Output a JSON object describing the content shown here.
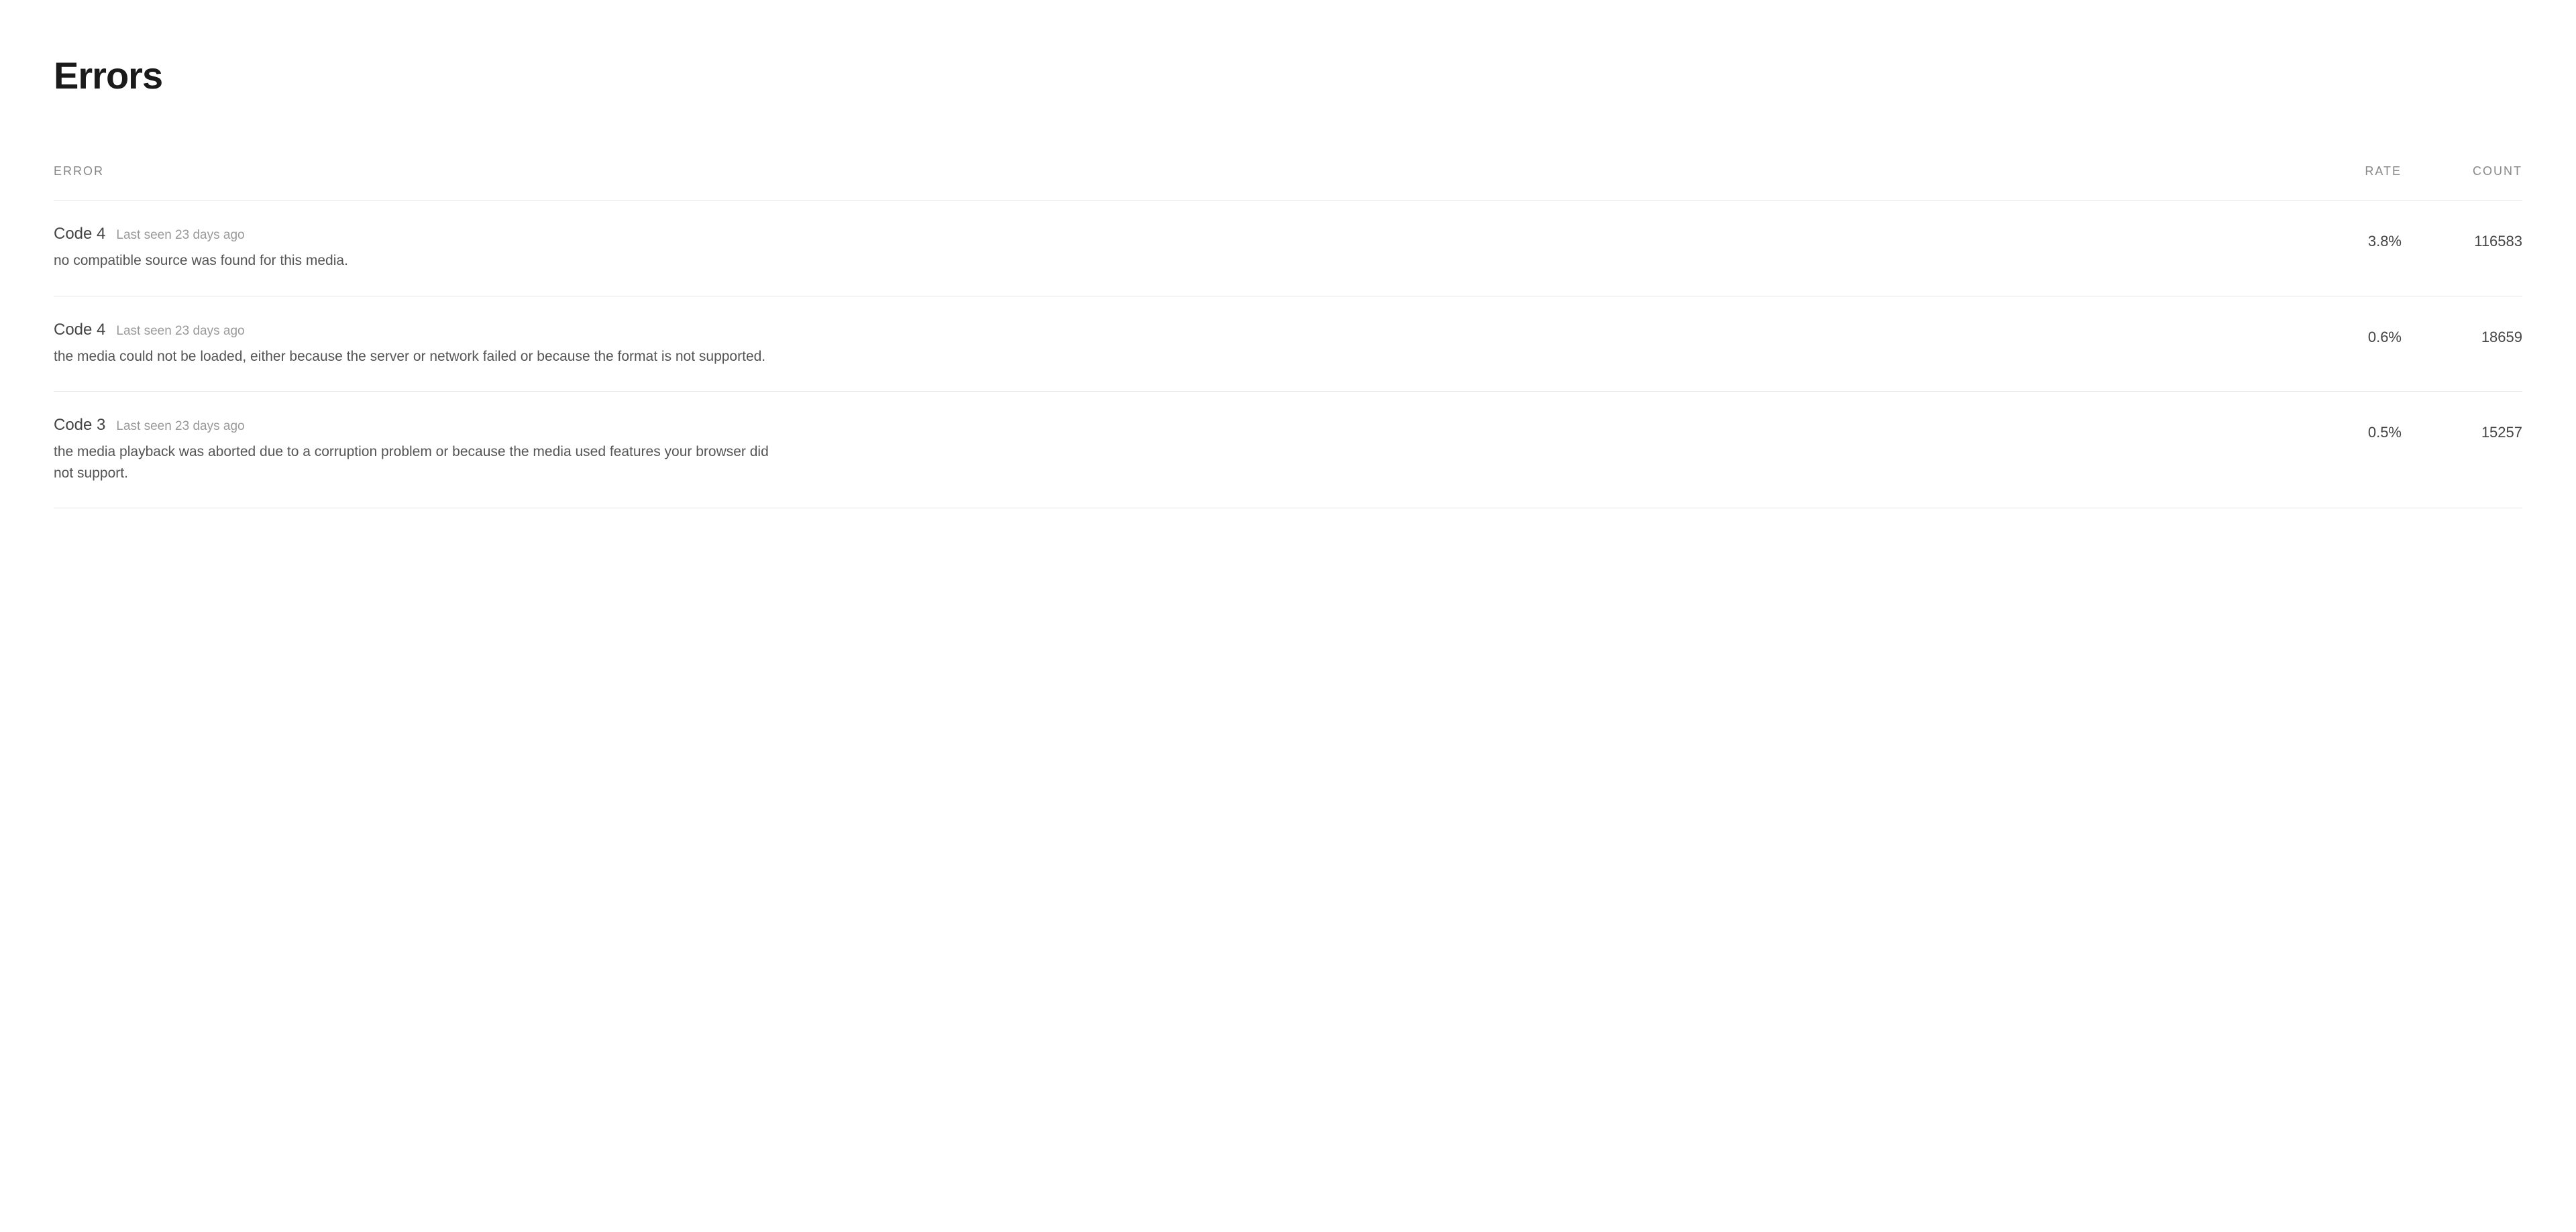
{
  "page": {
    "title": "Errors"
  },
  "table": {
    "headers": {
      "error": "ERROR",
      "rate": "RATE",
      "count": "COUNT"
    },
    "rows": [
      {
        "code": "Code 4",
        "last_seen": "Last seen 23 days ago",
        "description": "no compatible source was found for this media.",
        "rate": "3.8%",
        "count": "116583"
      },
      {
        "code": "Code 4",
        "last_seen": "Last seen 23 days ago",
        "description": "the media could not be loaded, either because the server or network failed or because the format is not supported.",
        "rate": "0.6%",
        "count": "18659"
      },
      {
        "code": "Code 3",
        "last_seen": "Last seen 23 days ago",
        "description": "the media playback was aborted due to a corruption problem or because the media used features your browser did not support.",
        "rate": "0.5%",
        "count": "15257"
      }
    ]
  }
}
